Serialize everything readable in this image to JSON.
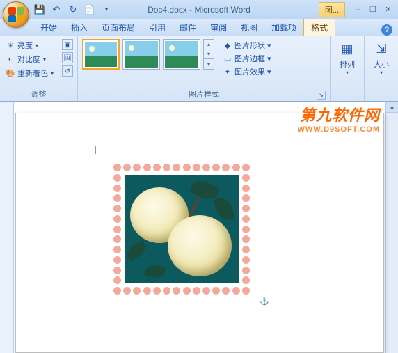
{
  "title": "Doc4.docx - Microsoft Word",
  "context_label": "图...",
  "qat": {
    "save": "💾",
    "undo": "↶",
    "redo": "↻",
    "new": "📄"
  },
  "win": {
    "min": "–",
    "restore": "❐",
    "close": "✕"
  },
  "tabs": {
    "home": "开始",
    "insert": "插入",
    "layout": "页面布局",
    "references": "引用",
    "mail": "邮件",
    "review": "审阅",
    "view": "视图",
    "addins": "加载项",
    "format": "格式"
  },
  "ribbon": {
    "adjust": {
      "label": "调整",
      "brightness": "亮度",
      "contrast": "对比度",
      "recolor": "重新着色"
    },
    "styles": {
      "label": "图片样式",
      "shape": "图片形状",
      "border": "图片边框",
      "effects": "图片效果"
    },
    "arrange": {
      "label": "排列"
    },
    "size": {
      "label": "大小"
    }
  },
  "watermark": {
    "line1": "第九软件网",
    "line2": "WWW.D9SOFT.COM"
  }
}
